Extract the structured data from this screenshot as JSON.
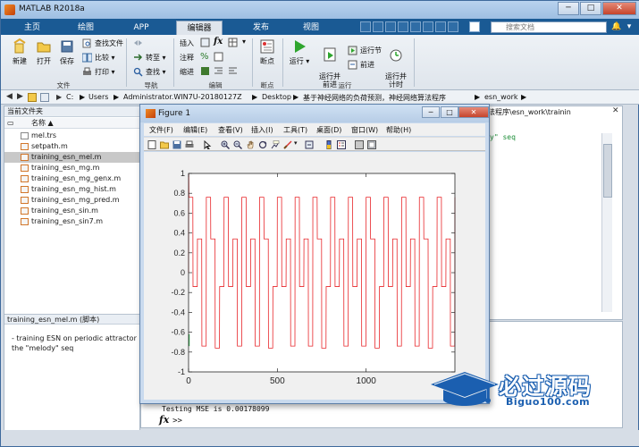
{
  "window": {
    "title": "MATLAB R2018a",
    "buttons": {
      "minimize": "─",
      "maximize": "□",
      "close": "✕"
    }
  },
  "tabs": [
    {
      "label": "主页"
    },
    {
      "label": "绘图"
    },
    {
      "label": "APP"
    },
    {
      "label": "编辑器"
    },
    {
      "label": "发布"
    },
    {
      "label": "视图"
    }
  ],
  "search": {
    "placeholder": "搜索文档"
  },
  "ribbon": {
    "file": {
      "new": "新建",
      "open": "打开",
      "save": "保存",
      "find_files": "查找文件",
      "compare": "比较",
      "print": "打印",
      "group": "文件"
    },
    "navigate": {
      "goto": "转至",
      "find": "查找",
      "group": "导航"
    },
    "edit": {
      "insert": "插入",
      "comment": "注释",
      "indent": "缩进",
      "fx": "fx",
      "group": "编辑"
    },
    "breakpoints": {
      "label": "断点",
      "group": "断点"
    },
    "run": {
      "run": "运行",
      "run_advance": "运行并\n前进",
      "run_section": "运行节",
      "advance": "前进",
      "run_time": "运行并\n计时",
      "group": "运行"
    }
  },
  "address": {
    "crumbs": [
      "C:",
      "Users",
      "Administrator.WIN7U-20180127Z",
      "Desktop",
      "基于神经网络的负荷预测，神经网络算法程序",
      "esn_work"
    ]
  },
  "current_folder": {
    "title": "当前文件夹",
    "column": "名称 ▲",
    "files": [
      {
        "name": "mel.trs",
        "selected": false
      },
      {
        "name": "setpath.m",
        "selected": false
      },
      {
        "name": "training_esn_mel.m",
        "selected": true
      },
      {
        "name": "training_esn_mg.m",
        "selected": false
      },
      {
        "name": "training_esn_mg_genx.m",
        "selected": false
      },
      {
        "name": "training_esn_mg_hist.m",
        "selected": false
      },
      {
        "name": "training_esn_mg_pred.m",
        "selected": false
      },
      {
        "name": "training_esn_sin.m",
        "selected": false
      },
      {
        "name": "training_esn_sin7.m",
        "selected": false
      }
    ],
    "details_title": "training_esn_mel.m  (脚本)",
    "details_lines": [
      "- training ESN on periodic attractor \"",
      "the \"melody\" seq"
    ]
  },
  "editor": {
    "path": "法程序\\esn_work\\trainin",
    "snippet": "y\" seq"
  },
  "command": {
    "output": "Testing MSE is 0.00178099",
    "fx": "fx",
    "prompt": ">>"
  },
  "figure": {
    "title": "Figure 1",
    "buttons": {
      "minimize": "─",
      "maximize": "□",
      "close": "✕"
    },
    "menu": [
      "文件(F)",
      "编辑(E)",
      "查看(V)",
      "插入(I)",
      "工具(T)",
      "桌面(D)",
      "窗口(W)",
      "帮助(H)"
    ]
  },
  "chart_data": {
    "type": "line",
    "title": "",
    "xlabel": "",
    "ylabel": "",
    "xlim": [
      0,
      1500
    ],
    "ylim": [
      -1,
      1
    ],
    "xticks": [
      0,
      500,
      1000
    ],
    "yticks": [
      -1,
      -0.8,
      -0.6,
      -0.4,
      -0.2,
      0,
      0.2,
      0.4,
      0.6,
      0.8,
      1
    ],
    "colors": {
      "main": "#e8262a",
      "teacher": "#2db34a"
    },
    "series": [
      {
        "period": 25,
        "pattern": [
          0.76,
          -0.14,
          0.34,
          -0.74,
          0.76,
          0.34,
          -0.76,
          -0.14,
          0.76,
          -0.14,
          0.34,
          -0.74
        ],
        "initial_spike": 1.0
      }
    ]
  },
  "watermark": {
    "cn": "必过源码",
    "en": "Biguo100.com"
  }
}
